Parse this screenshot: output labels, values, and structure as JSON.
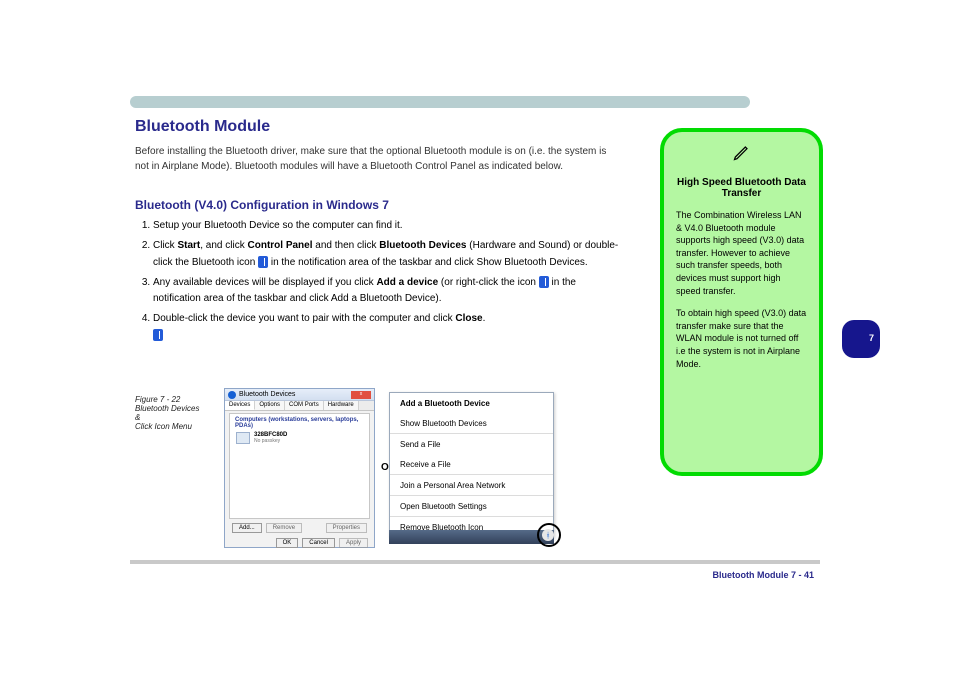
{
  "header": {},
  "section_title": "Bluetooth Module",
  "intro": "Before installing the Bluetooth driver, ",
  "intro_rest": "make sure that the optional Bluetooth module is on (i.e. the system is not in Airplane Mode). Bluetooth modules will have a Bluetooth Control Panel as indicated below.",
  "steps_title": "Bluetooth (V4.0) Configuration in Windows 7",
  "steps": [
    "Setup your Bluetooth Device so the computer can find it.",
    {
      "prefix": "Click ",
      "b1": "Start",
      "mid": ", and click ",
      "b2": "Control Panel",
      "suffix": " and then click "
    },
    {
      "text": "(Hardware and Sound) or double-click the Bluetooth icon",
      "b3": "Bluetooth Devices"
    },
    "in the notification area of the taskbar and click Show Bluetooth Devices.",
    {
      "prefix": "Any available devices will be displayed if you click ",
      "b1": "Add a device",
      "rest": " (or right-click the icon "
    },
    "in the notification area of the taskbar and click Add a Bluetooth Device).",
    {
      "prefix": "Double-click the device you want to pair with the computer and click ",
      "b1": "Close",
      "suffix": "."
    }
  ],
  "note": {
    "title": "High Speed Bluetooth Data Transfer",
    "body1": "The Combination Wireless LAN & V4.0 Bluetooth module supports high speed (V3.0) data transfer. However to achieve such transfer speeds, both devices must support high speed transfer.",
    "body2": "To obtain high speed (V3.0) data transfer make sure that the WLAN module is not turned off i.e the system is not in Airplane Mode."
  },
  "dialog": {
    "title": "Bluetooth Devices",
    "tabs": [
      "Devices",
      "Options",
      "COM Ports",
      "Hardware"
    ],
    "group": "Computers (workstations, servers, laptops, PDAs)",
    "device_name": "328BFC80D",
    "device_sub": "No passkey",
    "btn_add": "Add...",
    "btn_remove": "Remove",
    "btn_props": "Properties",
    "btn_ok": "OK",
    "btn_cancel": "Cancel",
    "btn_apply": "Apply"
  },
  "ctx": {
    "items": [
      "Add a Bluetooth Device",
      "Show Bluetooth Devices",
      "Send a File",
      "Receive a File",
      "Join a Personal Area Network",
      "Open Bluetooth Settings",
      "Remove Bluetooth Icon"
    ]
  },
  "or_label": "Or",
  "fig_caption": "Figure 7 - 22\nBluetooth Devices\n&\nClick Icon Menu",
  "footer": "Bluetooth Module 7 - 41",
  "side_tab": "7"
}
